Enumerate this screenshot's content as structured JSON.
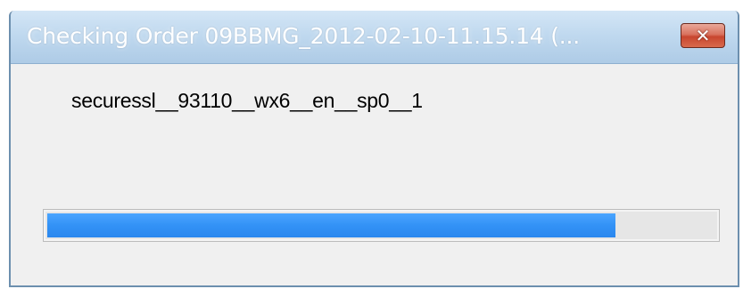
{
  "window": {
    "title": "Checking Order 09BBMG_2012-02-10-11.15.14 (...",
    "close_icon": "close-icon"
  },
  "content": {
    "file_label": "securessl__93110__wx6__en__sp0__1"
  },
  "progress": {
    "value_fraction": 0.85,
    "fill_color": "#3392f6"
  }
}
